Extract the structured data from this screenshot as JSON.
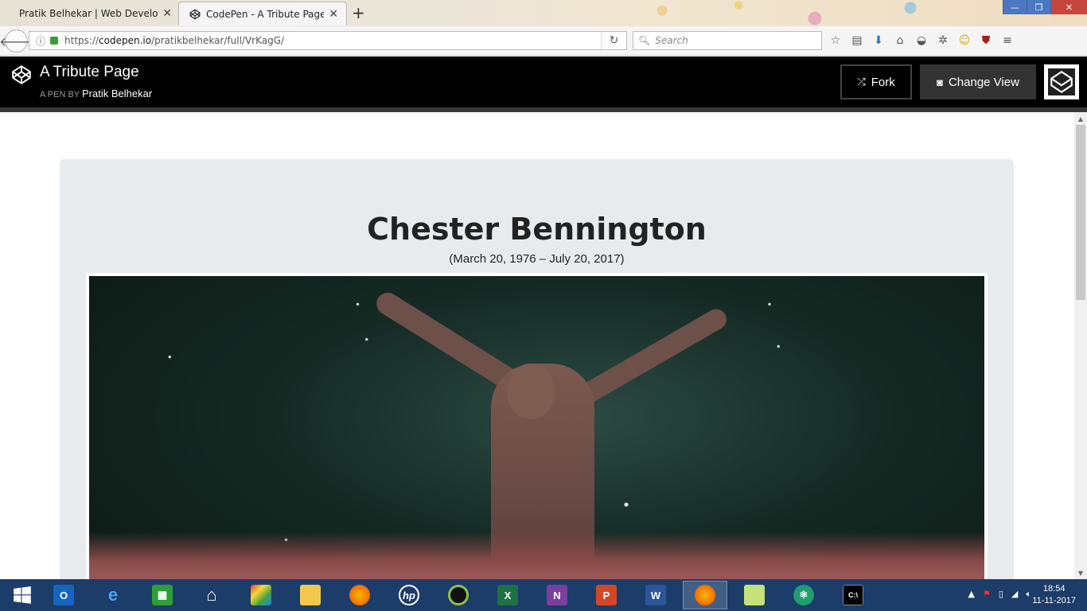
{
  "browser": {
    "tabs": [
      {
        "label": "Pratik Belhekar | Web Developer",
        "active": false
      },
      {
        "label": "CodePen - A Tribute Page",
        "active": true
      }
    ],
    "url_prefix": "https://",
    "url_host": "codepen.io",
    "url_path": "/pratikbelhekar/full/VrKagG/",
    "search_placeholder": "Search",
    "window_controls": [
      "minimize",
      "restore",
      "close"
    ]
  },
  "codepen": {
    "title": "A Tribute Page",
    "byline_prefix": "A PEN BY",
    "author": "Pratik Belhekar",
    "fork_label": "Fork",
    "change_view_label": "Change View"
  },
  "tribute": {
    "name": "Chester Bennington",
    "dates": "(March 20, 1976 – July 20, 2017)"
  },
  "taskbar": {
    "apps": [
      "start",
      "outlook",
      "internet-explorer",
      "store",
      "home",
      "paint",
      "file-explorer",
      "firefox",
      "hp",
      "media",
      "excel",
      "onenote",
      "powerpoint",
      "word",
      "firefox-active",
      "sticky",
      "atom",
      "cmd"
    ],
    "time": "18:54",
    "date": "11-11-2017"
  },
  "colors": {
    "codepen_header": "#000000",
    "card_bg": "#e8ebee",
    "taskbar": "#1c3c6a"
  }
}
